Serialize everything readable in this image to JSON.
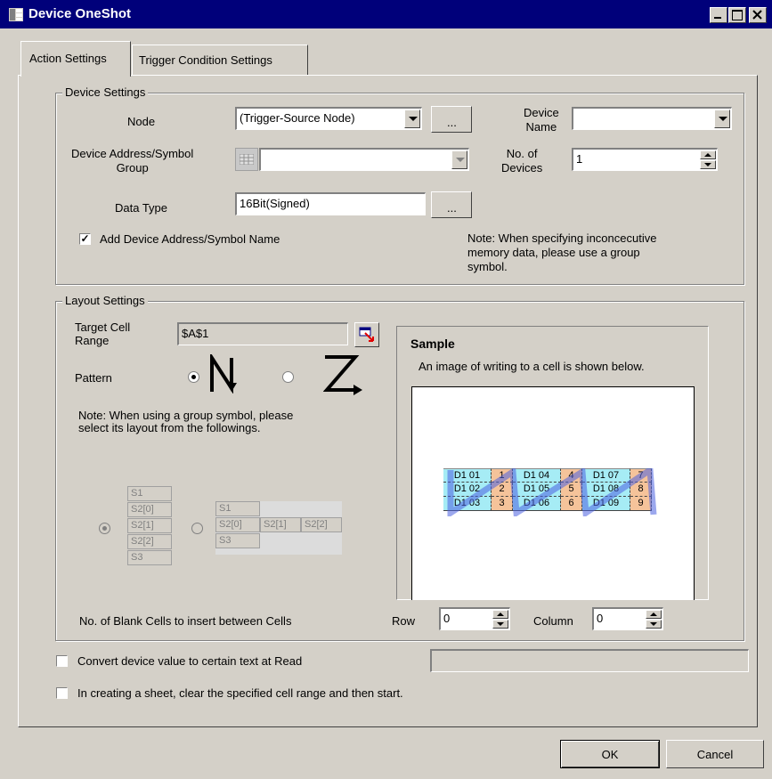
{
  "window": {
    "title": "Device OneShot"
  },
  "tabs": [
    {
      "label": "Action Settings"
    },
    {
      "label": "Trigger Condition Settings"
    }
  ],
  "device_settings": {
    "group_label": "Device Settings",
    "node_label": "Node",
    "node_value": "(Trigger-Source Node)",
    "browse_label": "...",
    "device_name_label_1": "Device",
    "device_name_label_2": "Name",
    "device_name_value": "",
    "address_label_1": "Device Address/Symbol",
    "address_label_2": "Group",
    "address_value": "",
    "num_devices_label_1": "No. of",
    "num_devices_label_2": "Devices",
    "num_devices_value": "1",
    "data_type_label": "Data Type",
    "data_type_value": "16Bit(Signed)",
    "add_name_label": "Add Device Address/Symbol Name",
    "add_name_checked": true,
    "note_1": "Note: When specifying inconcecutive",
    "note_2": "memory data, please use a group",
    "note_3": "symbol."
  },
  "layout_settings": {
    "group_label": "Layout Settings",
    "target_label_1": "Target Cell",
    "target_label_2": "Range",
    "target_value": "$A$1",
    "pattern_label": "Pattern",
    "pattern_selected": "vertical",
    "group_note_1": "Note: When using a group symbol,  please",
    "group_note_2": "select its layout from the followings.",
    "vertical_layout": [
      "S1",
      "S2[0]",
      "S2[1]",
      "S2[2]",
      "S3"
    ],
    "horizontal_layout": {
      "row1": "S1",
      "row2": [
        "S2[0]",
        "S2[1]",
        "S2[2]"
      ],
      "row3": "S3"
    },
    "sample_title": "Sample",
    "sample_desc": "An image of writing to a cell is shown below.",
    "sample_grid": [
      [
        "D1 01",
        "1",
        "D1 04",
        "4",
        "D1 07",
        "7"
      ],
      [
        "D1 02",
        "2",
        "D1 05",
        "5",
        "D1 08",
        "8"
      ],
      [
        "D1 03",
        "3",
        "D1 06",
        "6",
        "D1 09",
        "9"
      ]
    ],
    "blank_cells_label": "No. of Blank Cells to insert between Cells",
    "row_label": "Row",
    "row_value": "0",
    "column_label": "Column",
    "column_value": "0"
  },
  "options": {
    "convert_label": "Convert device value to certain text at Read",
    "convert_checked": false,
    "convert_value": "",
    "clear_label": "In creating a sheet, clear the specified cell range and then start.",
    "clear_checked": false
  },
  "buttons": {
    "ok": "OK",
    "cancel": "Cancel"
  },
  "colors": {
    "titlebar": "#00007a",
    "face": "#d4d0c8",
    "cell_cyan": "#a6ecf5",
    "cell_orange": "#f5c39a",
    "path_blue": "#4a60e0"
  }
}
